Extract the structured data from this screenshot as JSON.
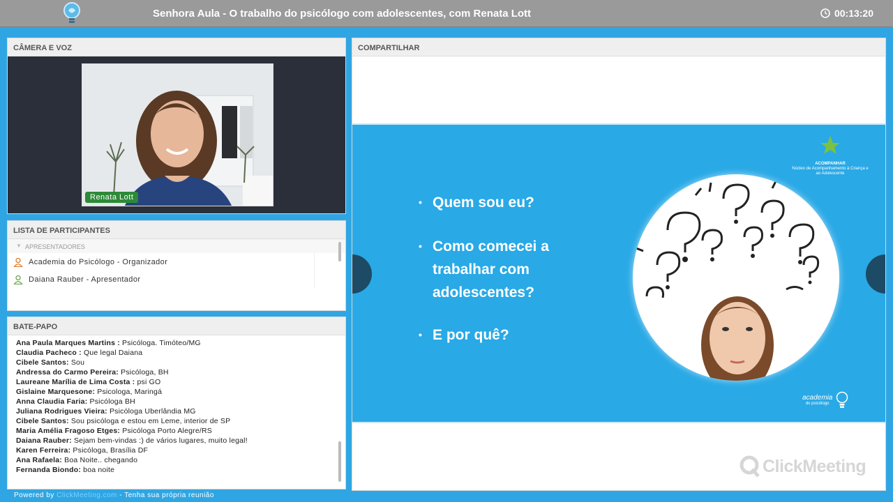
{
  "header": {
    "title": "Senhora Aula - O trabalho do psicólogo com adolescentes, com Renata Lott",
    "timer": "00:13:20"
  },
  "camera": {
    "label": "CÂMERA E VOZ",
    "presenter_name": "Renata Lott"
  },
  "participants": {
    "label": "LISTA DE PARTICIPANTES",
    "group": "APRESENTADORES",
    "items": [
      {
        "name": "Academia do Psicólogo - Organizador",
        "color": "#e07b2a"
      },
      {
        "name": "Daiana Rauber - Apresentador",
        "color": "#6aa84f"
      }
    ]
  },
  "chat": {
    "label": "BATE-PAPO",
    "messages": [
      {
        "author": "Ana Paula  Marques Martins :",
        "text": " Psicóloga. Timóteo/MG"
      },
      {
        "author": "Claudia Pacheco :",
        "text": " Que legal Daiana"
      },
      {
        "author": "Cibele Santos:",
        "text": " Sou"
      },
      {
        "author": "Andressa do Carmo Pereira:",
        "text": " Psicóloga, BH"
      },
      {
        "author": "Laureane Marília de Lima Costa :",
        "text": " psi GO"
      },
      {
        "author": "Gislaine Marquesone:",
        "text": " Psicologa, Maringá"
      },
      {
        "author": "Anna Claudia Faria:",
        "text": " Psicóloga BH"
      },
      {
        "author": "Juliana Rodrigues Vieira:",
        "text": " Psicóloga Uberlândia MG"
      },
      {
        "author": "Cibele Santos:",
        "text": " Sou psicóloga e estou em Leme, interior de SP"
      },
      {
        "author": "Maria Amélia Fragoso Etges:",
        "text": " Psicóloga Porto Alegre/RS"
      },
      {
        "author": "Daiana Rauber:",
        "text": " Sejam bem-vindas :) de vários lugares, muito legal!"
      },
      {
        "author": "Karen Ferreira:",
        "text": " Psicóloga, Brasília DF"
      },
      {
        "author": "Ana Rafaela:",
        "text": " Boa Noite.. chegando"
      },
      {
        "author": "Fernanda Biondo:",
        "text": " boa noite"
      }
    ]
  },
  "footer": {
    "powered": "Powered by",
    "brand": "ClickMeeting.com",
    "cta": "- Tenha sua própria reunião"
  },
  "share": {
    "label": "COMPARTILHAR",
    "bullets": [
      "Quem sou eu?",
      "Como comecei a trabalhar com adolescentes?",
      "E por quê?"
    ],
    "logo_top_name": "ACOMPANHAR",
    "logo_top_sub": "Núcleo de Acompanhamento à Criança e ao Adolescente",
    "logo_bottom_name": "academia",
    "logo_bottom_sub": "do psicólogo",
    "watermark": "ClickMeeting"
  }
}
